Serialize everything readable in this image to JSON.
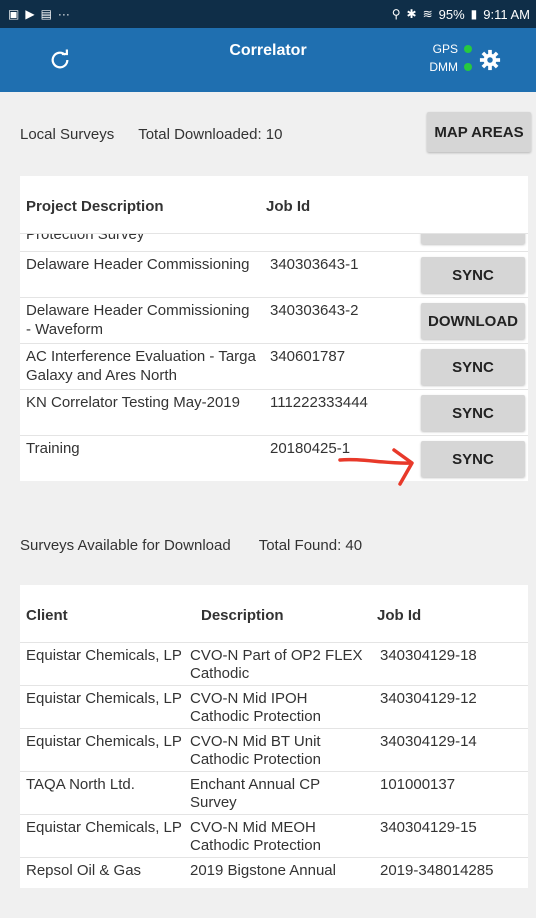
{
  "status_bar": {
    "left_icons": [
      "picture-icon",
      "play-icon",
      "screen-icon",
      "more-icon"
    ],
    "left_more": "···",
    "right_text": "95%",
    "time": "9:11 AM"
  },
  "app_bar": {
    "title": "Correlator",
    "gps_label": "GPS",
    "dmm_label": "DMM",
    "indicator_color": "#27c93f",
    "bg_color": "#1f6fb0"
  },
  "local": {
    "label": "Local Surveys",
    "total_label": "Total Downloaded: 10",
    "map_button": "MAP AREAS",
    "columns": [
      "Project Description",
      "Job Id"
    ],
    "partial_row_text": "Protection Survey",
    "rows": [
      {
        "desc": "Delaware Header Commissioning",
        "job": "340303643-1",
        "action": "SYNC"
      },
      {
        "desc": "Delaware Header Commissioning - Waveform",
        "job": "340303643-2",
        "action": "DOWNLOAD"
      },
      {
        "desc": "AC Interference Evaluation - Targa Galaxy and Ares North",
        "job": "340601787",
        "action": "SYNC"
      },
      {
        "desc": "KN Correlator Testing May-2019",
        "job": "111222333444",
        "action": "SYNC"
      },
      {
        "desc": "Training",
        "job": "20180425-1",
        "action": "SYNC"
      }
    ]
  },
  "available": {
    "label": "Surveys Available for Download",
    "total_label": "Total Found: 40",
    "columns": [
      "Client",
      "Description",
      "Job Id"
    ],
    "rows": [
      {
        "client": "Equistar Chemicals, LP",
        "desc": "CVO-N Part of OP2 FLEX Cathodic",
        "job": "340304129-18"
      },
      {
        "client": "Equistar Chemicals, LP",
        "desc": "CVO-N Mid IPOH Cathodic Protection",
        "job": "340304129-12"
      },
      {
        "client": "Equistar Chemicals, LP",
        "desc": "CVO-N Mid BT Unit Cathodic Protection",
        "job": "340304129-14"
      },
      {
        "client": "TAQA North Ltd.",
        "desc": "Enchant Annual CP Survey",
        "job": "101000137"
      },
      {
        "client": "Equistar Chemicals, LP",
        "desc": "CVO-N Mid MEOH Cathodic Protection",
        "job": "340304129-15"
      },
      {
        "client": "Repsol Oil & Gas",
        "desc": "2019 Bigstone Annual",
        "job": "2019-348014285"
      }
    ]
  }
}
